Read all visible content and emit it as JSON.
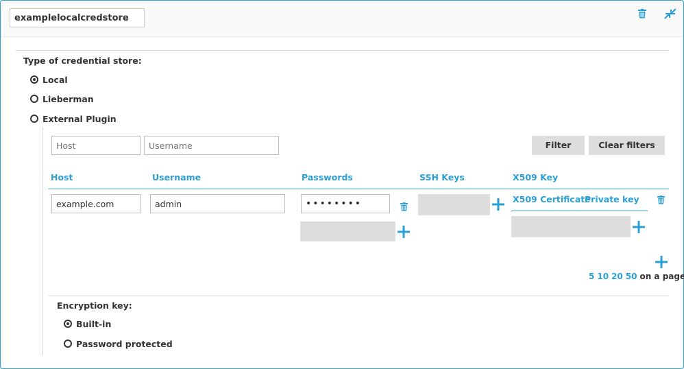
{
  "store": {
    "name": "examplelocalcredstore"
  },
  "icons": {
    "delete": "trash-icon",
    "collapse": "collapse-arrows-icon",
    "add": "plus-icon"
  },
  "credential_store_type": {
    "label": "Type of credential store:",
    "options": [
      {
        "label": "Local",
        "checked": true
      },
      {
        "label": "Lieberman",
        "checked": false
      },
      {
        "label": "External Plugin",
        "checked": false
      }
    ]
  },
  "filters": {
    "host_placeholder": "Host",
    "username_placeholder": "Username",
    "filter_button": "Filter",
    "clear_button": "Clear filters"
  },
  "table": {
    "columns": [
      "Host",
      "Username",
      "Passwords",
      "SSH Keys",
      "X509 Key"
    ],
    "x509_subcolumns": [
      "X509 Certificate",
      "Private key"
    ],
    "rows": [
      {
        "host": "example.com",
        "username": "admin",
        "password": "••••••••"
      }
    ]
  },
  "pagination": {
    "sizes": [
      "5",
      "10",
      "20",
      "50"
    ],
    "suffix": "on a page"
  },
  "encryption": {
    "label": "Encryption key:",
    "options": [
      {
        "label": "Built-in",
        "checked": true
      },
      {
        "label": "Password protected",
        "checked": false
      }
    ]
  },
  "colors": {
    "accent": "#2a9fd6",
    "button_bg": "#dddddd",
    "placeholder_box": "#dddddd"
  }
}
